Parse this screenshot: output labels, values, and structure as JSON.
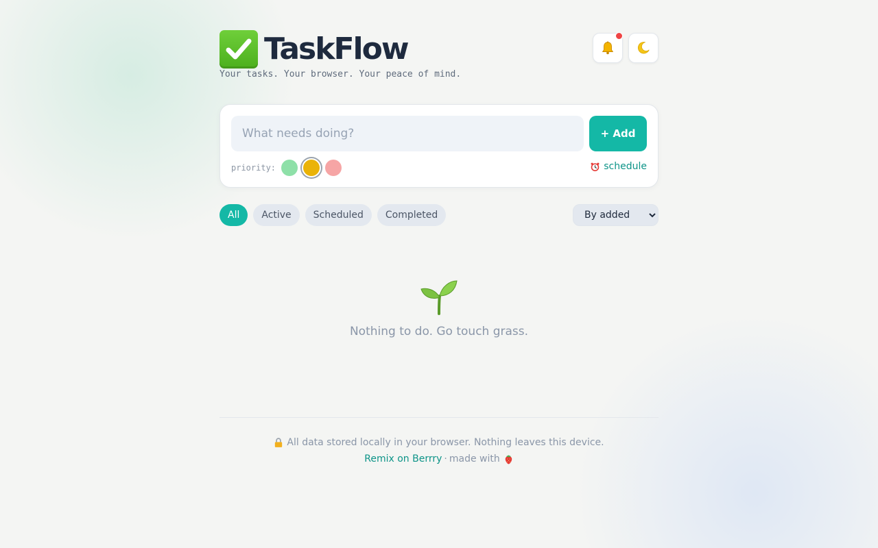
{
  "header": {
    "title": "TaskFlow",
    "tagline": "Your tasks. Your browser. Your peace of mind.",
    "logo_icon": "check-mark-icon",
    "notifications_icon": "bell-icon",
    "theme_icon": "moon-icon"
  },
  "composer": {
    "input_placeholder": "What needs doing?",
    "input_value": "",
    "add_label": "+ Add",
    "priority_label": "priority:",
    "priorities": [
      "low",
      "medium",
      "high"
    ],
    "selected_priority": "medium",
    "schedule_label": "schedule",
    "schedule_icon": "alarm-clock-icon"
  },
  "filters": {
    "items": [
      {
        "label": "All",
        "active": true
      },
      {
        "label": "Active",
        "active": false
      },
      {
        "label": "Scheduled",
        "active": false
      },
      {
        "label": "Completed",
        "active": false
      }
    ],
    "sort_selected": "By added"
  },
  "empty_state": {
    "icon": "seedling-icon",
    "message": "Nothing to do. Go touch grass."
  },
  "footer": {
    "privacy_icon": "lock-icon",
    "privacy_text": "All data stored locally in your browser. Nothing leaves this device.",
    "remix_label": "Remix on Berrry",
    "separator": "·",
    "made_with": "made with",
    "made_with_icon": "strawberry-icon"
  },
  "colors": {
    "accent": "#14b8a6",
    "priority_low": "#8ee0a8",
    "priority_medium": "#eab308",
    "priority_high": "#f6a5a5",
    "notification_dot": "#ef4444"
  }
}
